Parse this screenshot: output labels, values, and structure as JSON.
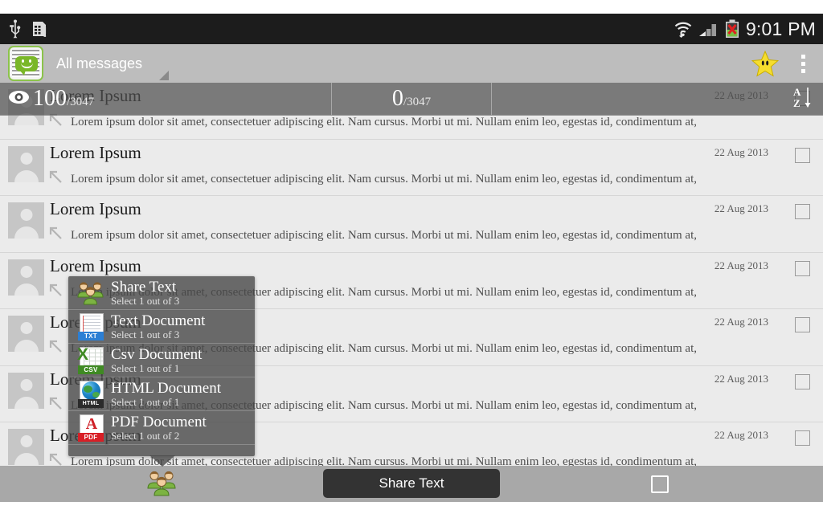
{
  "statusbar": {
    "icons": [
      "usb-icon",
      "sim-card-icon",
      "wifi-icon",
      "signal-icon",
      "battery-icon"
    ],
    "time": "9:01 PM"
  },
  "actionbar": {
    "app_icon": "messages-app-icon",
    "title": "All messages",
    "dropdown_caret": "spinner-caret-icon",
    "star_icon": "star-icon",
    "overflow_icon": "overflow-menu-icon"
  },
  "counterbar": {
    "eye_icon": "eye-icon",
    "selected_count": "100",
    "selected_total": "/3047",
    "marked_count": "0",
    "marked_total": "/3047",
    "sort_icon": "sort-az-icon"
  },
  "list": {
    "rows": [
      {
        "title": "Lorem Ipsum",
        "body": "Lorem ipsum dolor sit amet, consectetuer adipiscing elit. Nam cursus. Morbi ut mi. Nullam enim leo, egestas id, condimentum at,",
        "date": "22 Aug 2013"
      },
      {
        "title": "Lorem Ipsum",
        "body": "Lorem ipsum dolor sit amet, consectetuer adipiscing elit. Nam cursus. Morbi ut mi. Nullam enim leo, egestas id, condimentum at,",
        "date": "22 Aug 2013"
      },
      {
        "title": "Lorem Ipsum",
        "body": "Lorem ipsum dolor sit amet, consectetuer adipiscing elit. Nam cursus. Morbi ut mi. Nullam enim leo, egestas id, condimentum at,",
        "date": "22 Aug 2013"
      },
      {
        "title": "Lorem Ipsum",
        "body": "Lorem ipsum dolor sit amet, consectetuer adipiscing elit. Nam cursus. Morbi ut mi. Nullam enim leo, egestas id, condimentum at,",
        "date": "22 Aug 2013"
      },
      {
        "title": "Lorem Ipsum",
        "body": "Lorem ipsum dolor sit amet, consectetuer adipiscing elit. Nam cursus. Morbi ut mi. Nullam enim leo, egestas id, condimentum at,",
        "date": "22 Aug 2013"
      },
      {
        "title": "Lorem Ipsum",
        "body": "Lorem ipsum dolor sit amet, consectetuer adipiscing elit. Nam cursus. Morbi ut mi. Nullam enim leo, egestas id, condimentum at,",
        "date": "22 Aug 2013"
      },
      {
        "title": "Lorem Ipsum",
        "body": "Lorem ipsum dolor sit amet, consectetuer adipiscing elit. Nam cursus. Morbi ut mi. Nullam enim leo, egestas id, condimentum at,",
        "date": "22 Aug 2013"
      }
    ]
  },
  "popup": {
    "items": [
      {
        "icon": "people-group-icon",
        "label": "Share Text",
        "sub": "Select 1 out of 3"
      },
      {
        "icon": "txt-document-icon",
        "label": "Text Document",
        "sub": "Select 1 out of 3"
      },
      {
        "icon": "csv-document-icon",
        "label": "Csv Document",
        "sub": "Select 1 out of 1"
      },
      {
        "icon": "html-document-icon",
        "label": "HTML Document",
        "sub": "Select 1 out of 1"
      },
      {
        "icon": "pdf-document-icon",
        "label": "PDF Document",
        "sub": "Select 1 out of 2"
      }
    ],
    "icon_labels": {
      "txt": "TXT",
      "csv": "CSV",
      "html": "HTML",
      "pdf": "PDF"
    }
  },
  "bottombar": {
    "people_icon": "people-group-icon",
    "share_button": "Share Text",
    "recents_icon": "recents-square-icon"
  },
  "colors": {
    "statusbar_bg": "#1c1c1c",
    "actionbar_bg": "#bdbdbd",
    "list_bg": "#ebebeb",
    "bottombar_bg": "#a8a8a8",
    "accent_green": "#8bc34a",
    "button_bg": "#333333"
  }
}
